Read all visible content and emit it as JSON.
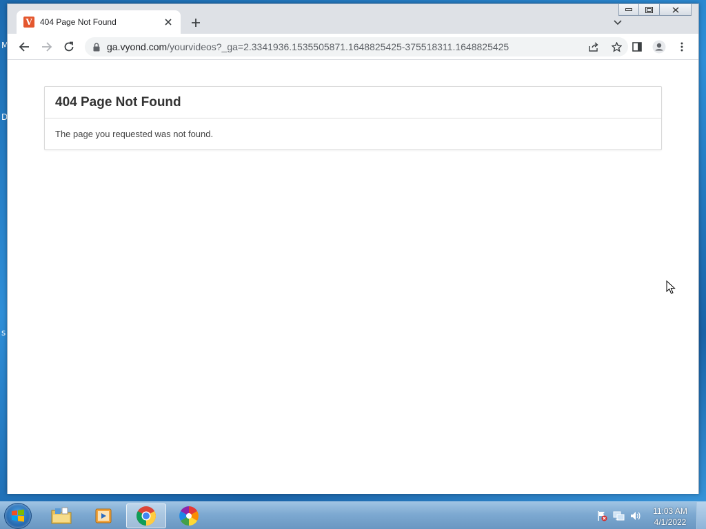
{
  "desktop": {
    "edge_glyphs": [
      "M",
      "D",
      "s"
    ]
  },
  "browser": {
    "tab": {
      "title": "404 Page Not Found",
      "favicon_letter": "V",
      "favicon_color": "#e4572e"
    },
    "address_bar": {
      "host": "ga.vyond.com",
      "path": "/yourvideos?_ga=2.3341936.1535505871.1648825425-375518311.1648825425"
    }
  },
  "page": {
    "heading": "404 Page Not Found",
    "message": "The page you requested was not found."
  },
  "taskbar": {
    "apps": [
      "windows-explorer",
      "windows-media-player",
      "google-chrome",
      "photos"
    ],
    "active_app": "google-chrome",
    "clock": {
      "time": "11:03 AM",
      "date": "4/1/2022"
    }
  },
  "colors": {
    "accent": "#1a73e8",
    "tab_strip": "#dee1e6",
    "omnibox": "#f1f3f4",
    "taskbar": "#7da9d1"
  }
}
